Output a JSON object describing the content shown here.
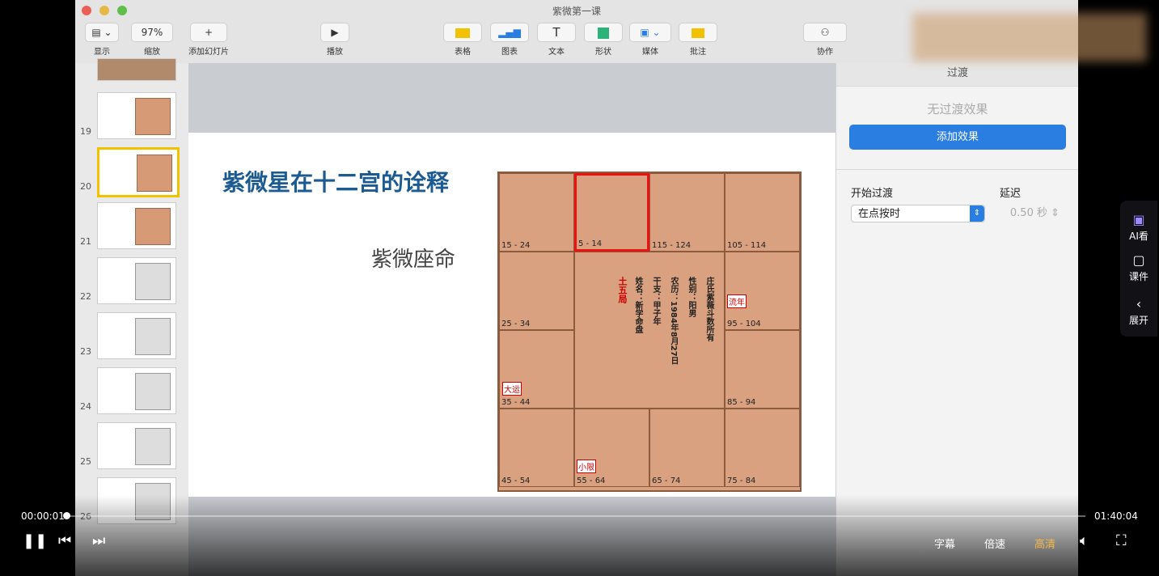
{
  "window": {
    "title": "紫微第一课"
  },
  "toolbar": {
    "view_label": "显示",
    "zoom_value": "97%",
    "zoom_label": "缩放",
    "add_slide_label": "添加幻灯片",
    "play_label": "播放",
    "table_label": "表格",
    "chart_label": "图表",
    "text_label": "文本",
    "shape_label": "形状",
    "media_label": "媒体",
    "comment_label": "批注",
    "collab_label": "协作"
  },
  "sidebar": {
    "slides": [
      {
        "num": "19",
        "style": "color"
      },
      {
        "num": "20",
        "style": "color",
        "selected": true
      },
      {
        "num": "21",
        "style": "color"
      },
      {
        "num": "22",
        "style": "grey"
      },
      {
        "num": "23",
        "style": "grey"
      },
      {
        "num": "24",
        "style": "grey"
      },
      {
        "num": "25",
        "style": "grey"
      },
      {
        "num": "26",
        "style": "grey"
      }
    ]
  },
  "slide": {
    "title": "紫微星在十二宫的诠释",
    "subtitle": "紫微座命",
    "chart": {
      "top_ranges": [
        "15 - 24",
        "5 - 14",
        "115 - 124",
        "105 - 114"
      ],
      "left_ranges": [
        "25 - 34",
        "35 - 44"
      ],
      "right_ranges": [
        "95 - 104",
        "85 - 94"
      ],
      "bottom_ranges": [
        "45 - 54",
        "55 - 64",
        "65 - 74",
        "75 - 84"
      ],
      "center_lines": [
        "庄氏紫薇斗数所有",
        "性别：阳男",
        "农历：1984年8月27日",
        "干支：甲子年",
        "姓名：新学命盘"
      ],
      "center_red": "土五局",
      "marks": [
        "大运",
        "流年",
        "小限"
      ]
    }
  },
  "inspector": {
    "header": "过渡",
    "no_transition": "无过渡效果",
    "add_effect": "添加效果",
    "start_label": "开始过渡",
    "delay_label": "延迟",
    "start_value": "在点按时",
    "delay_value": "0.50 秒"
  },
  "player": {
    "current_time": "00:00:01",
    "total_time": "01:40:04",
    "progress": 0.0002,
    "subtitle_label": "字幕",
    "speed_label": "倍速",
    "quality_label": "高清",
    "side": {
      "ai_label": "AI看",
      "course_label": "课件",
      "expand_label": "展开"
    }
  },
  "colors": {
    "accent": "#2a7de1",
    "title_blue": "#1c5a92",
    "chart_bg": "#d9a17f",
    "quality": "#f5b94a"
  }
}
